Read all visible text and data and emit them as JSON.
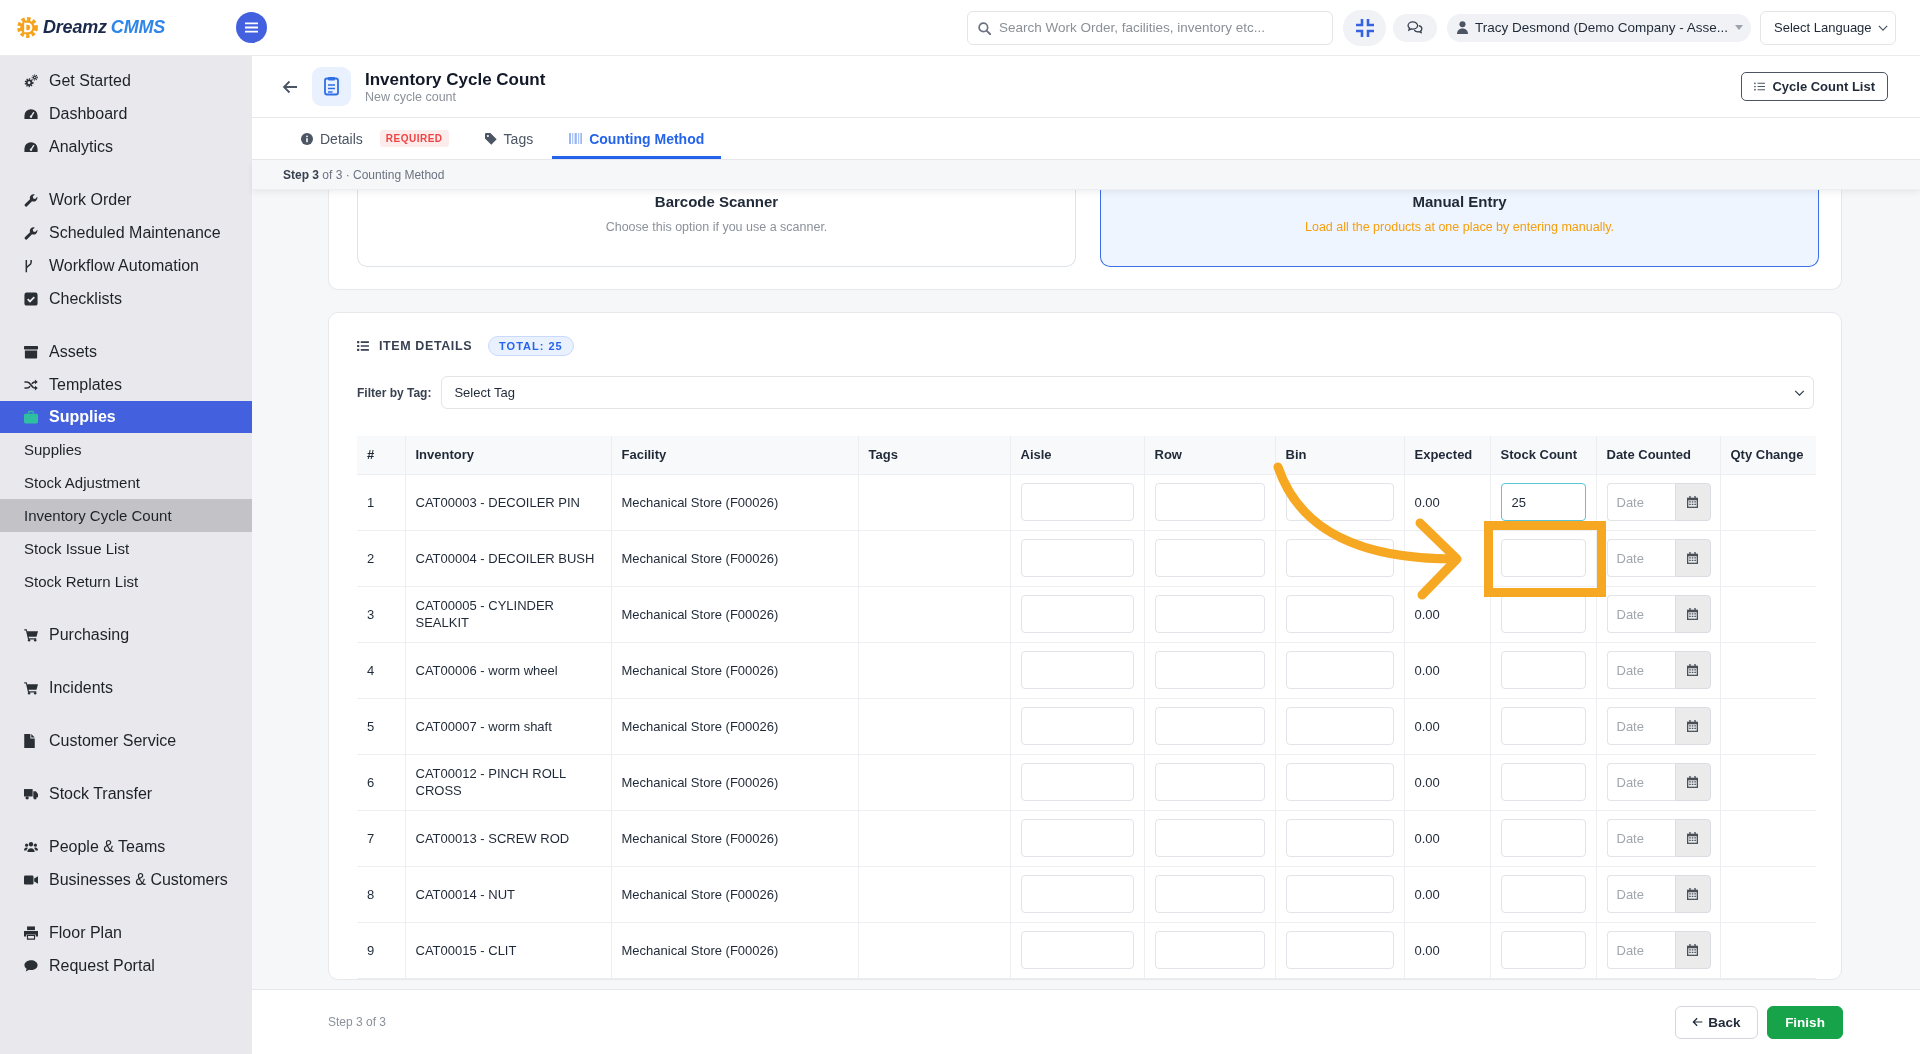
{
  "brand": {
    "name": "Dreamz",
    "product": "CMMS"
  },
  "topbar": {
    "search": {
      "placeholder": "Search Work Order, facilities, inventory etc..."
    },
    "user": "Tracy Desmond (Demo Company - Asse...",
    "language": "Select Language"
  },
  "sidebar": {
    "groups": [
      {
        "items": [
          {
            "label": "Get Started",
            "selected": false
          },
          {
            "label": "Dashboard",
            "selected": false
          },
          {
            "label": "Analytics",
            "selected": false
          }
        ]
      },
      {
        "items": [
          {
            "label": "Work Order",
            "selected": false
          },
          {
            "label": "Scheduled Maintenance",
            "selected": false
          },
          {
            "label": "Workflow Automation",
            "selected": false
          },
          {
            "label": "Checklists",
            "selected": false
          }
        ]
      },
      {
        "items": [
          {
            "label": "Assets",
            "selected": false
          },
          {
            "label": "Templates",
            "selected": false
          },
          {
            "label": "Supplies",
            "selected": true,
            "children": [
              {
                "label": "Supplies",
                "selected": false
              },
              {
                "label": "Stock Adjustment",
                "selected": false
              },
              {
                "label": "Inventory Cycle Count",
                "selected": true
              },
              {
                "label": "Stock Issue List",
                "selected": false
              },
              {
                "label": "Stock Return List",
                "selected": false
              }
            ]
          }
        ]
      },
      {
        "items": [
          {
            "label": "Purchasing",
            "selected": false
          }
        ]
      },
      {
        "items": [
          {
            "label": "Incidents",
            "selected": false
          }
        ]
      },
      {
        "items": [
          {
            "label": "Customer Service",
            "selected": false
          }
        ]
      },
      {
        "items": [
          {
            "label": "Stock Transfer",
            "selected": false
          }
        ]
      },
      {
        "items": [
          {
            "label": "People & Teams",
            "selected": false
          },
          {
            "label": "Businesses & Customers",
            "selected": false
          }
        ]
      },
      {
        "items": [
          {
            "label": "Floor Plan",
            "selected": false
          },
          {
            "label": "Request Portal",
            "selected": false
          }
        ]
      }
    ]
  },
  "header": {
    "title": "Inventory Cycle Count",
    "subtitle": "New cycle count",
    "action": "Cycle Count List"
  },
  "tabs": [
    {
      "label": "Details",
      "badge": "REQUIRED",
      "selected": false
    },
    {
      "label": "Tags",
      "selected": false
    },
    {
      "label": "Counting Method",
      "selected": true
    }
  ],
  "step": "**Step 3** of 3 · Counting Method",
  "methods": [
    {
      "title": "Barcode Scanner",
      "description": "Choose this option if you use a scanner.",
      "selected": false
    },
    {
      "title": "Manual Entry",
      "description": "Load all the products at one place by entering manually.",
      "selected": true
    }
  ],
  "items": {
    "heading": "ITEM DETAILS",
    "total": "TOTAL: 25",
    "filter": {
      "label": "Filter by Tag:",
      "value": "Select Tag"
    },
    "columns": [
      {
        "label": "#",
        "kind": "text"
      },
      {
        "label": "Inventory",
        "kind": "text"
      },
      {
        "label": "Facility",
        "kind": "text"
      },
      {
        "label": "Tags",
        "kind": "tags"
      },
      {
        "label": "Aisle",
        "kind": "input"
      },
      {
        "label": "Row",
        "kind": "input"
      },
      {
        "label": "Bin",
        "kind": "input"
      },
      {
        "label": "Expected",
        "kind": "text"
      },
      {
        "label": "Stock Count",
        "kind": "count"
      },
      {
        "label": "Date Counted",
        "kind": "date"
      },
      {
        "label": "Qty Change",
        "kind": "text"
      }
    ],
    "rows": [
      {
        "number": "1",
        "inventory": "CAT00003 - DECOILER PIN",
        "facility": "Mechanical Store (F00026)",
        "expected": "0.00",
        "stock_count": "25",
        "focused": true,
        "highlighted": false,
        "date_placeholder": "Date"
      },
      {
        "number": "2",
        "inventory": "CAT00004 - DECOILER BUSH",
        "facility": "Mechanical Store (F00026)",
        "focused": false,
        "highlighted": true,
        "date_placeholder": "Date"
      },
      {
        "number": "3",
        "inventory": "CAT00005 - CYLINDER SEALKIT",
        "facility": "Mechanical Store (F00026)",
        "expected": "0.00",
        "focused": false,
        "highlighted": false,
        "date_placeholder": "Date"
      },
      {
        "number": "4",
        "inventory": "CAT00006 - worm wheel",
        "facility": "Mechanical Store (F00026)",
        "expected": "0.00",
        "focused": false,
        "highlighted": false,
        "date_placeholder": "Date"
      },
      {
        "number": "5",
        "inventory": "CAT00007 - worm shaft",
        "facility": "Mechanical Store (F00026)",
        "expected": "0.00",
        "focused": false,
        "highlighted": false,
        "date_placeholder": "Date"
      },
      {
        "number": "6",
        "inventory": "CAT00012 - PINCH ROLL CROSS",
        "facility": "Mechanical Store (F00026)",
        "expected": "0.00",
        "focused": false,
        "highlighted": false,
        "date_placeholder": "Date"
      },
      {
        "number": "7",
        "inventory": "CAT00013 - SCREW ROD",
        "facility": "Mechanical Store (F00026)",
        "expected": "0.00",
        "focused": false,
        "highlighted": false,
        "date_placeholder": "Date"
      },
      {
        "number": "8",
        "inventory": "CAT00014 - NUT",
        "facility": "Mechanical Store (F00026)",
        "expected": "0.00",
        "focused": false,
        "highlighted": false,
        "date_placeholder": "Date"
      },
      {
        "number": "9",
        "inventory": "CAT00015 - CLIT",
        "facility": "Mechanical Store (F00026)",
        "expected": "0.00",
        "focused": false,
        "highlighted": false,
        "date_placeholder": "Date"
      }
    ]
  },
  "footer": {
    "step": "Step 3 of 3",
    "buttons": [
      {
        "label": "Back",
        "kind": "back"
      },
      {
        "label": "Finish",
        "kind": "submit"
      }
    ]
  }
}
